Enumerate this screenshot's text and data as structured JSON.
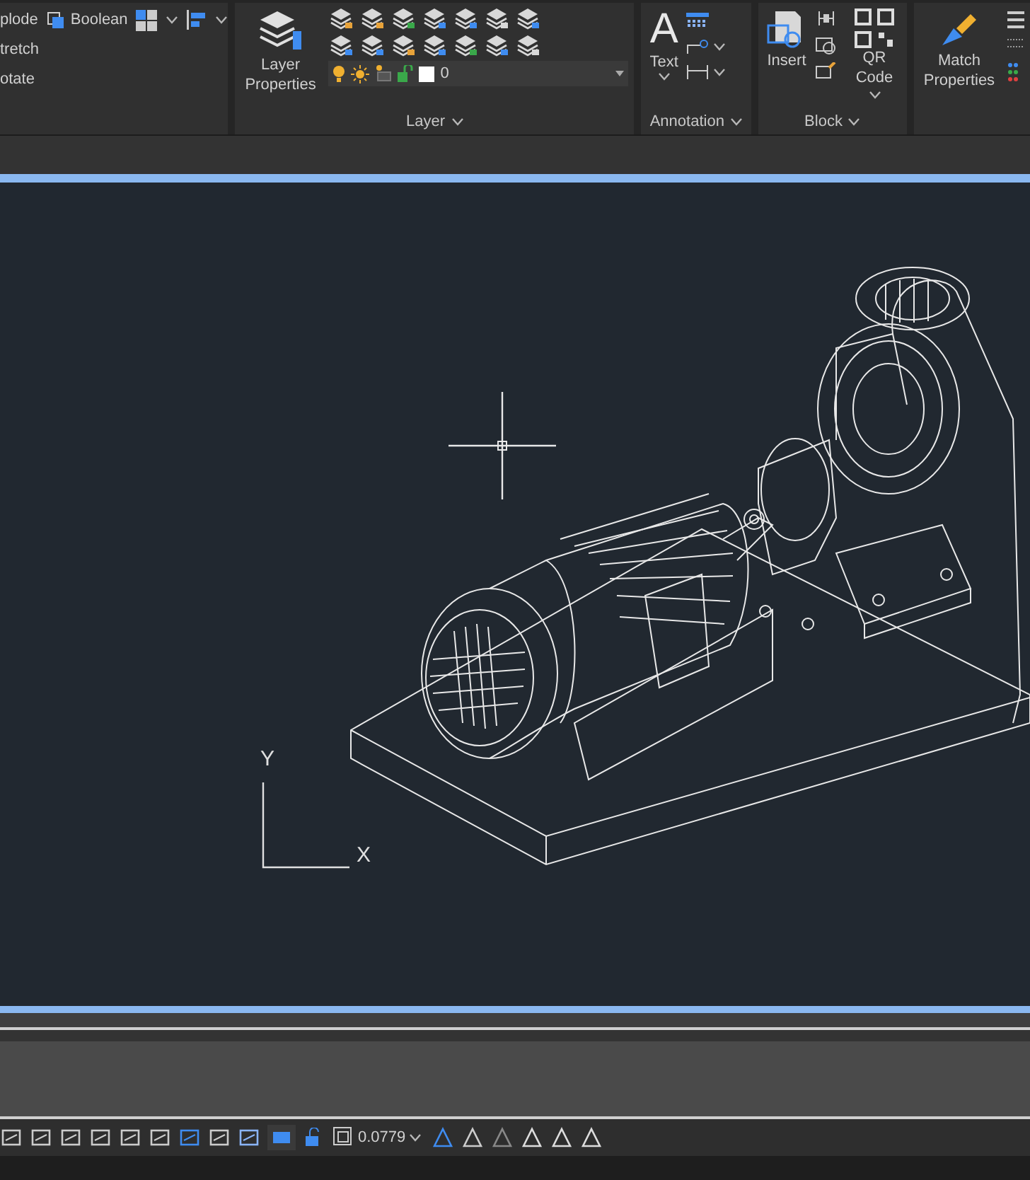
{
  "ribbon": {
    "modify_panel": {
      "rows": [
        {
          "label": "plode"
        },
        {
          "label": "tretch"
        },
        {
          "label": "otate"
        }
      ],
      "boolean_button": "Boolean"
    },
    "layer_panel": {
      "title": "Layer",
      "properties_button": "Layer Properties",
      "layer_dropdown": {
        "value": "0"
      }
    },
    "annotation_panel": {
      "title": "Annotation",
      "text_glyph": "A",
      "text_button": "Text"
    },
    "block_panel": {
      "title": "Block",
      "insert_button": "Insert",
      "qr_button": "QR Code"
    },
    "properties_panel": {
      "match_button": "Match Properties"
    }
  },
  "canvas": {
    "ucs": {
      "y_label": "Y",
      "x_label": "X"
    }
  },
  "status_bar": {
    "scale": "0.0779"
  }
}
